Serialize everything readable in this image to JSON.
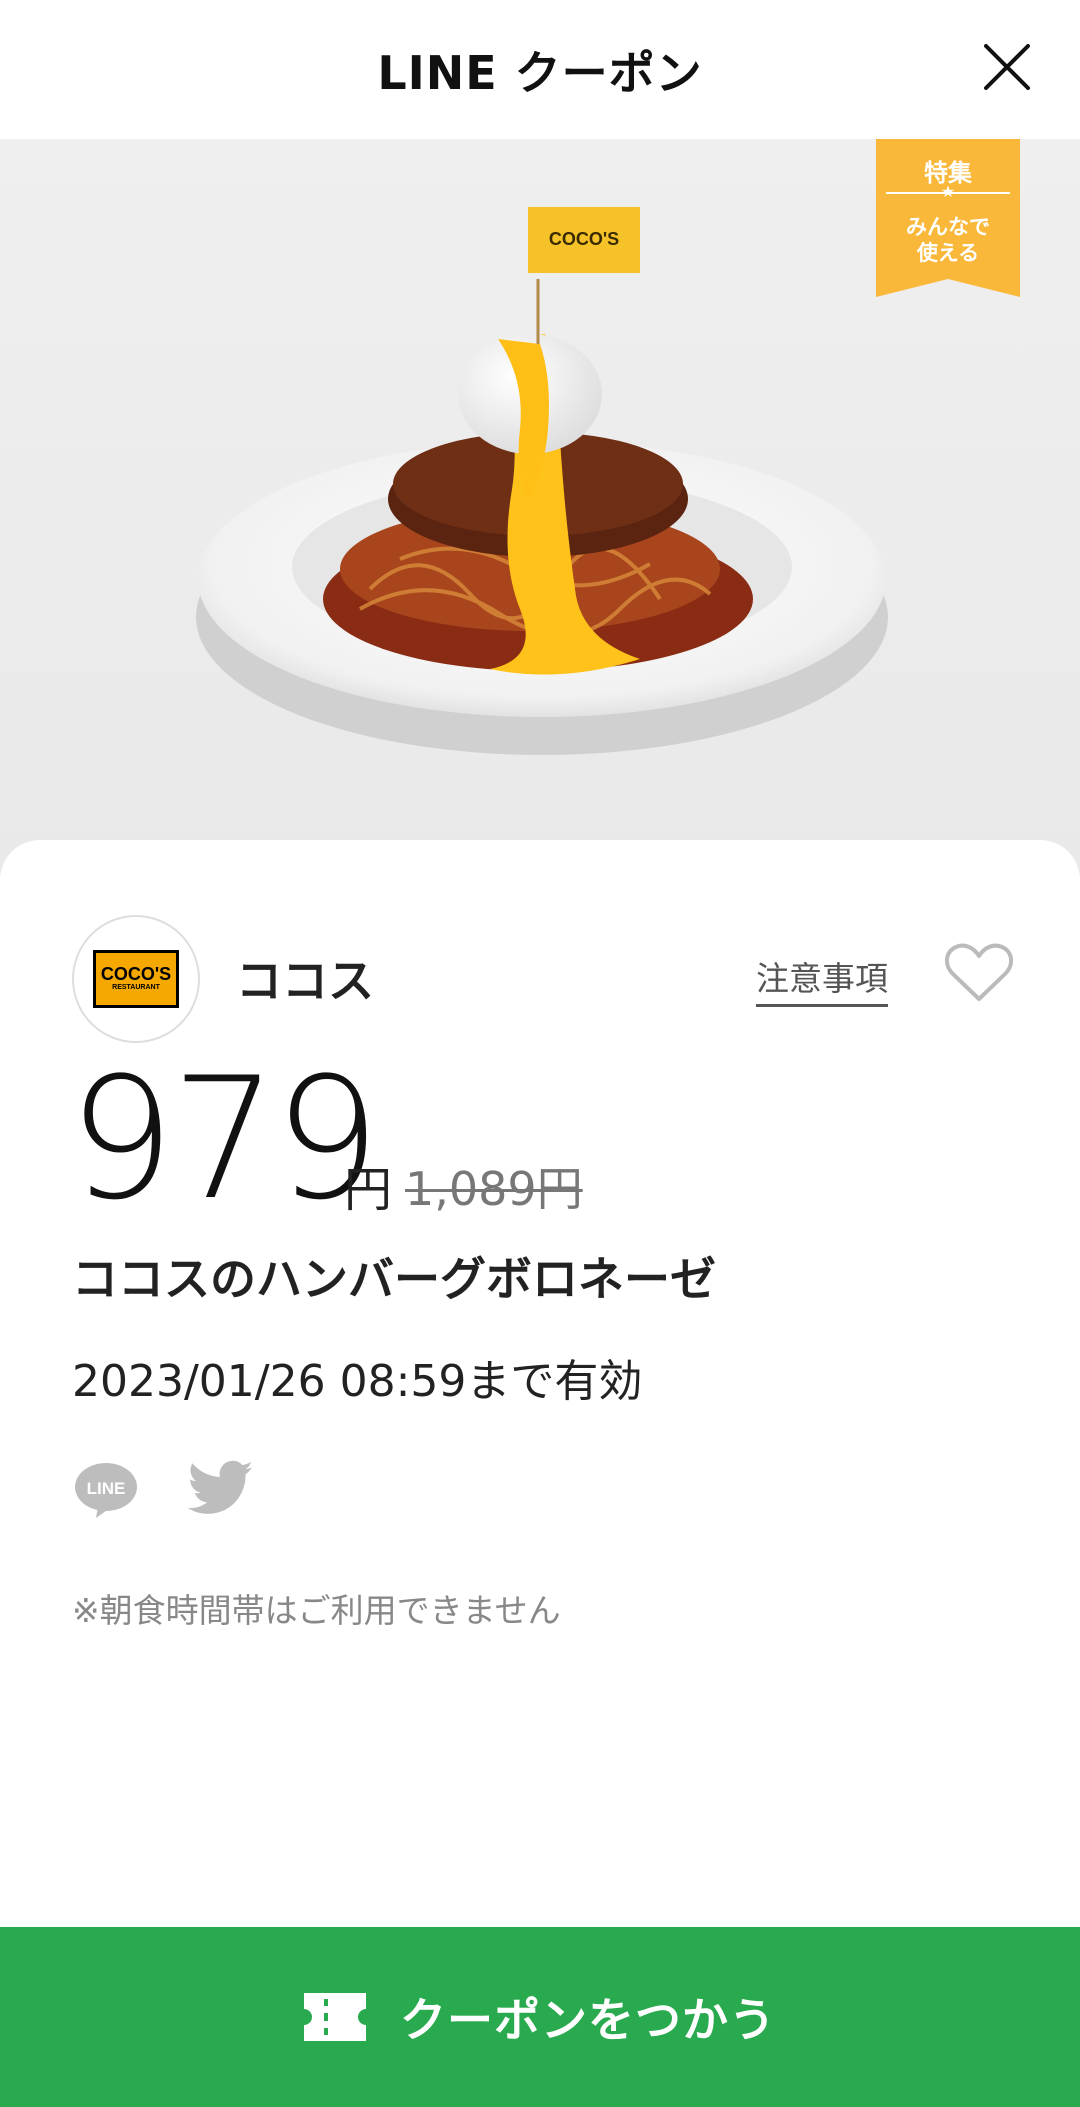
{
  "header": {
    "title": "LINE クーポン"
  },
  "badge": {
    "line1": "特集",
    "star": "★",
    "line2": "みんなで",
    "line3": "使える"
  },
  "hero": {
    "flag_text": "COCO'S"
  },
  "shop": {
    "logo_line1": "COCO'S",
    "logo_line2": "RESTAURANT",
    "name": "ココス",
    "notes_link": "注意事項"
  },
  "price": {
    "value": "979",
    "unit": "円",
    "original": "1,089円"
  },
  "item": {
    "title": "ココスのハンバーグボロネーゼ"
  },
  "validity": {
    "text": "2023/01/26  08:59まで有効"
  },
  "share": {
    "line_label": "LINE"
  },
  "note": {
    "text": "※朝食時間帯はご利用できません"
  },
  "cta": {
    "label": "クーポンをつかう"
  },
  "colors": {
    "accent_green": "#2AAA4E",
    "badge_orange": "#F9B83A",
    "brand_orange": "#F5A800"
  }
}
